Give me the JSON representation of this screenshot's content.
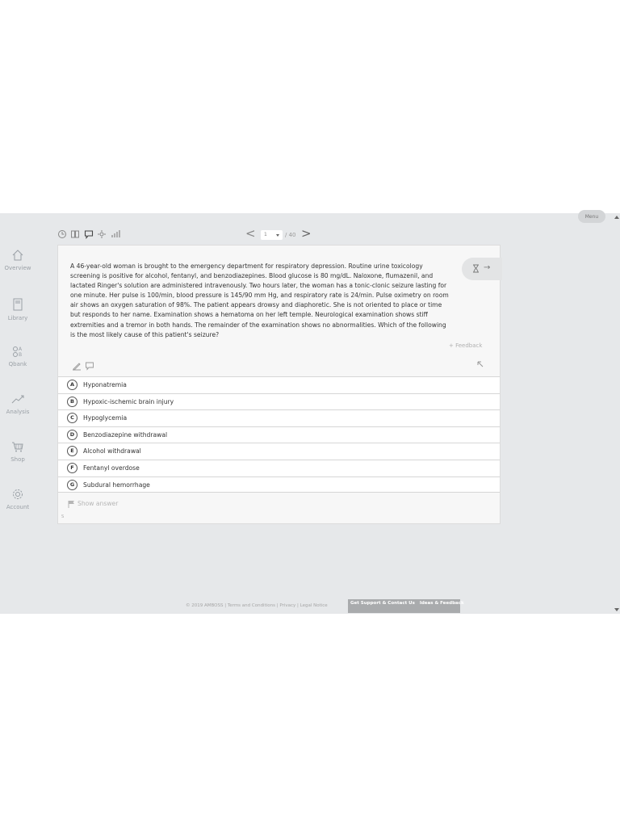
{
  "header": {
    "menu_label": "Menu"
  },
  "sidebar": {
    "items": [
      {
        "label": "Overview",
        "icon": "home-icon"
      },
      {
        "label": "Library",
        "icon": "book-icon"
      },
      {
        "label": "Qbank",
        "icon": "qbank-icon"
      },
      {
        "label": "Analysis",
        "icon": "chart-line-icon"
      },
      {
        "label": "Shop",
        "icon": "cart-icon"
      },
      {
        "label": "Account",
        "icon": "gear-icon"
      }
    ]
  },
  "toolbar": {
    "icons": [
      "clock-icon",
      "columns-icon",
      "comment-icon",
      "settings-icon",
      "bar-chart-icon"
    ]
  },
  "pager": {
    "current": "1",
    "total": "/ 40"
  },
  "question": {
    "stem": "A 46-year-old woman is brought to the emergency department for respiratory depression. Routine urine toxicology screening is positive for alcohol, fentanyl, and benzodiazepines. Blood glucose is 80 mg/dL. Naloxone, flumazenil, and lactated Ringer's solution are administered intravenously. Two hours later, the woman has a tonic-clonic seizure lasting for one minute. Her pulse is 100/min, blood pressure is 145/90 mm Hg, and respiratory rate is 24/min. Pulse oximetry on room air shows an oxygen saturation of 98%. The patient appears drowsy and diaphoretic. She is not oriented to place or time but responds to her name. Examination shows a hematoma on her left temple. Neurological examination shows stiff extremities and a tremor in both hands. The remainder of the examination shows no abnormalities. Which of the following is the most likely cause of this patient's seizure?",
    "feedback_label": "+ Feedback",
    "answers": [
      {
        "letter": "A",
        "text": "Hyponatremia"
      },
      {
        "letter": "B",
        "text": "Hypoxic-ischemic brain injury"
      },
      {
        "letter": "C",
        "text": "Hypoglycemia"
      },
      {
        "letter": "D",
        "text": "Benzodiazepine withdrawal"
      },
      {
        "letter": "E",
        "text": "Alcohol withdrawal"
      },
      {
        "letter": "F",
        "text": "Fentanyl overdose"
      },
      {
        "letter": "G",
        "text": "Subdural hemorrhage"
      }
    ],
    "show_answer_label": "Show answer",
    "tiny_mark": "S"
  },
  "footer": {
    "text": "© 2019 AMBOSS | Terms and Conditions | Privacy | Legal Notice",
    "support_label": "Get Support & Contact Us",
    "ideas_label": "Ideas & Feedback"
  }
}
